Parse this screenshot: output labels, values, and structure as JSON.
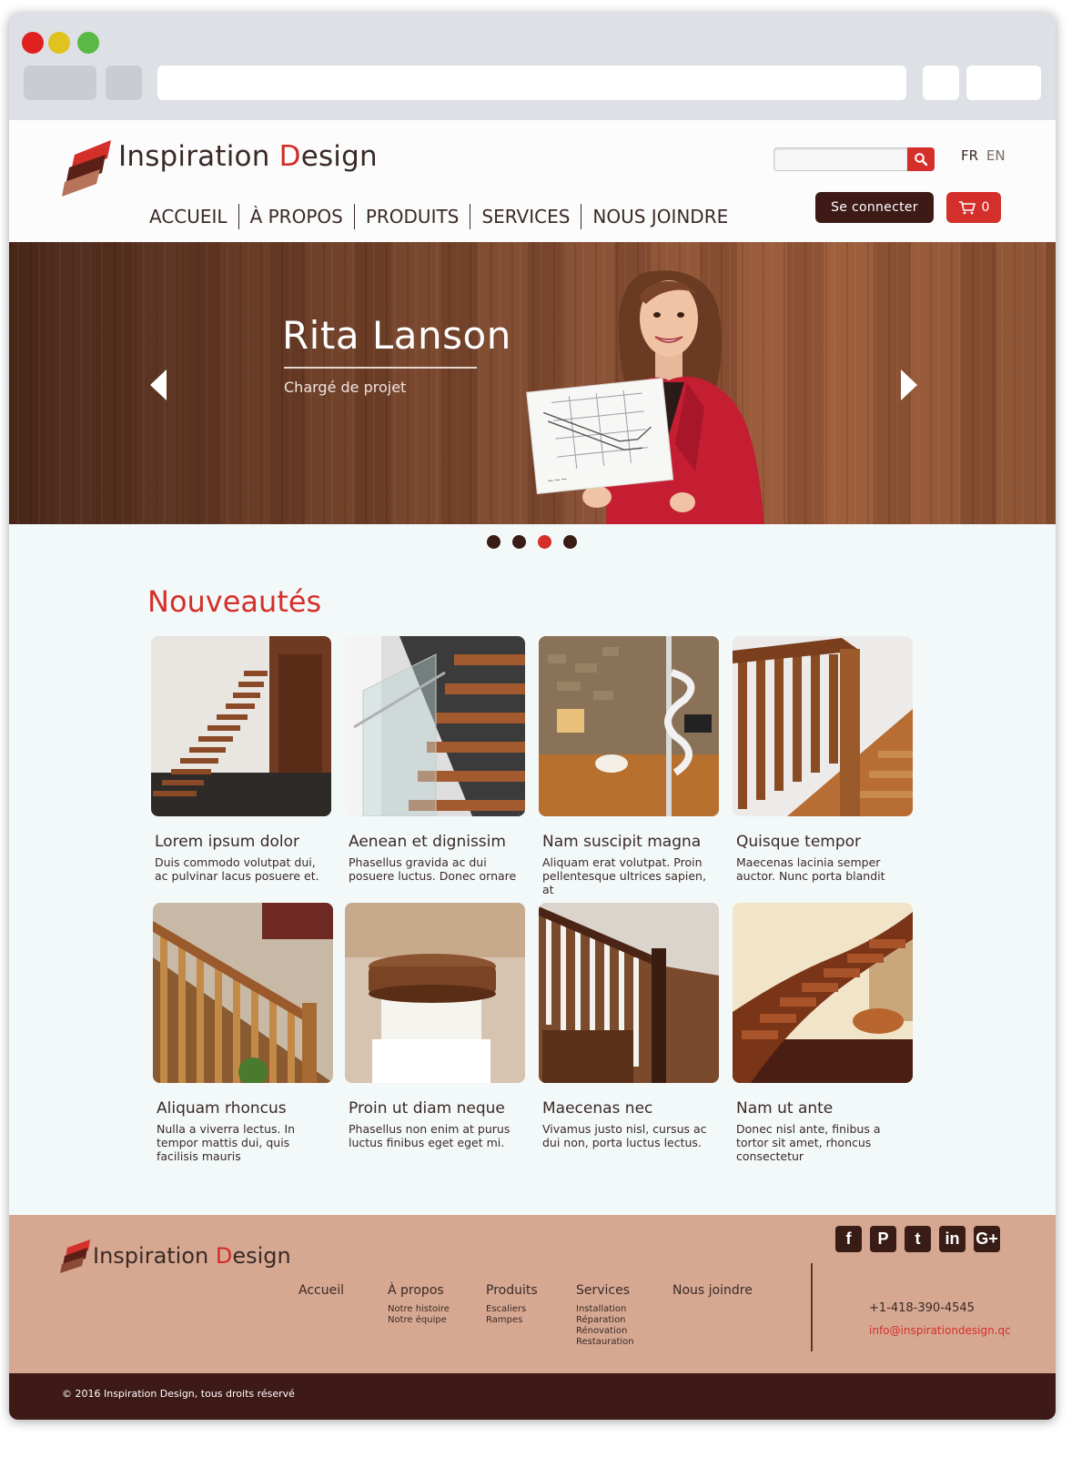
{
  "header": {
    "logo_word1": "Inspiration ",
    "logo_accent": "D",
    "logo_word2": "esign",
    "search_placeholder": "",
    "lang_fr": "FR",
    "lang_en": "EN",
    "nav": [
      "ACCUEIL",
      "À PROPOS",
      "PRODUITS",
      "SERVICES",
      "NOUS JOINDRE"
    ],
    "login_label": "Se connecter",
    "cart_count": "0"
  },
  "hero": {
    "name": "Rita Lanson",
    "role": "Chargé de projet",
    "slide_count": 4,
    "active_slide": 3
  },
  "section": {
    "title": "Nouveautés"
  },
  "products": [
    {
      "title": "Lorem ipsum dolor",
      "desc": "Duis commodo volutpat dui, ac pulvinar lacus posuere et."
    },
    {
      "title": "Aenean et dignissim",
      "desc": "Phasellus gravida ac dui posuere luctus. Donec ornare"
    },
    {
      "title": "Nam suscipit magna",
      "desc": "Aliquam erat volutpat. Proin pellentesque ultrices sapien, at"
    },
    {
      "title": "Quisque tempor",
      "desc": "Maecenas lacinia semper auctor. Nunc porta blandit"
    },
    {
      "title": "Aliquam rhoncus",
      "desc": "Nulla a viverra lectus. In tempor mattis dui, quis facilisis mauris"
    },
    {
      "title": "Proin ut diam neque",
      "desc": "Phasellus non enim at purus luctus finibus eget eget mi."
    },
    {
      "title": "Maecenas nec",
      "desc": "Vivamus justo nisl, cursus ac dui non, porta luctus lectus."
    },
    {
      "title": "Nam ut ante",
      "desc": "Donec nisl ante, finibus a tortor sit amet, rhoncus consectetur"
    }
  ],
  "footer": {
    "logo_word1": "Inspiration ",
    "logo_accent": "D",
    "logo_word2": "esign",
    "cols": [
      {
        "heading": "Accueil",
        "links": []
      },
      {
        "heading": "À propos",
        "links": [
          "Notre histoire",
          "Notre équipe"
        ]
      },
      {
        "heading": "Produits",
        "links": [
          "Escaliers",
          "Rampes"
        ]
      },
      {
        "heading": "Services",
        "links": [
          "Installation",
          "Réparation",
          "Rénovation",
          "Restauration"
        ]
      },
      {
        "heading": "Nous joindre",
        "links": []
      }
    ],
    "phone": "+1-418-390-4545",
    "email": "info@inspirationdesign.qc",
    "social": [
      "f",
      "P",
      "t",
      "in",
      "G+"
    ],
    "copyright": "© 2016 Inspiration Design, tous droits réservé"
  },
  "colors": {
    "accent": "#d42f2a",
    "dark": "#3d1a16",
    "footer_bg": "#d6a892"
  }
}
